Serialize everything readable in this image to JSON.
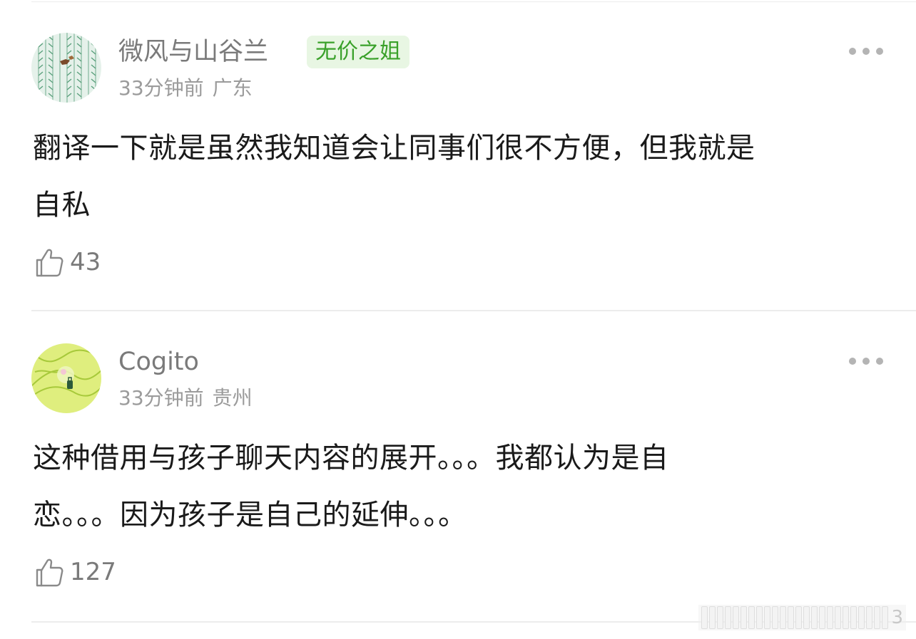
{
  "comments": [
    {
      "username": "微风与山谷兰",
      "badge": "无价之姐",
      "time": "33分钟前",
      "location": "广东",
      "text_lines": [
        "翻译一下就是虽然我知道会让同事们很不方便，但我就是",
        "自私"
      ],
      "likes": "43",
      "avatar_colors": {
        "background": "#e5f1ea",
        "stroke": "#5aa07c",
        "accent": "#7a4a2a"
      }
    },
    {
      "username": "Cogito",
      "badge": "",
      "time": "33分钟前",
      "location": "贵州",
      "text_lines": [
        "这种借用与孩子聊天内容的展开。。。我都认为是自",
        "恋。。。因为孩子是自己的延伸。。。"
      ],
      "likes": "127",
      "avatar_colors": {
        "background": "#dfee7e",
        "stroke": "#a7c93a",
        "accent": "#2c5a3a"
      }
    }
  ],
  "icons": {
    "more": "more-horizontal-icon",
    "like": "thumbs-up-icon"
  },
  "colors": {
    "username": "#7a7a7a",
    "meta": "#9b9b9b",
    "badge_bg": "#e8f6e3",
    "badge_text": "#3aa12a",
    "body_text": "#1a1a1a",
    "divider": "#ececec"
  },
  "watermark": {
    "char": "3"
  }
}
